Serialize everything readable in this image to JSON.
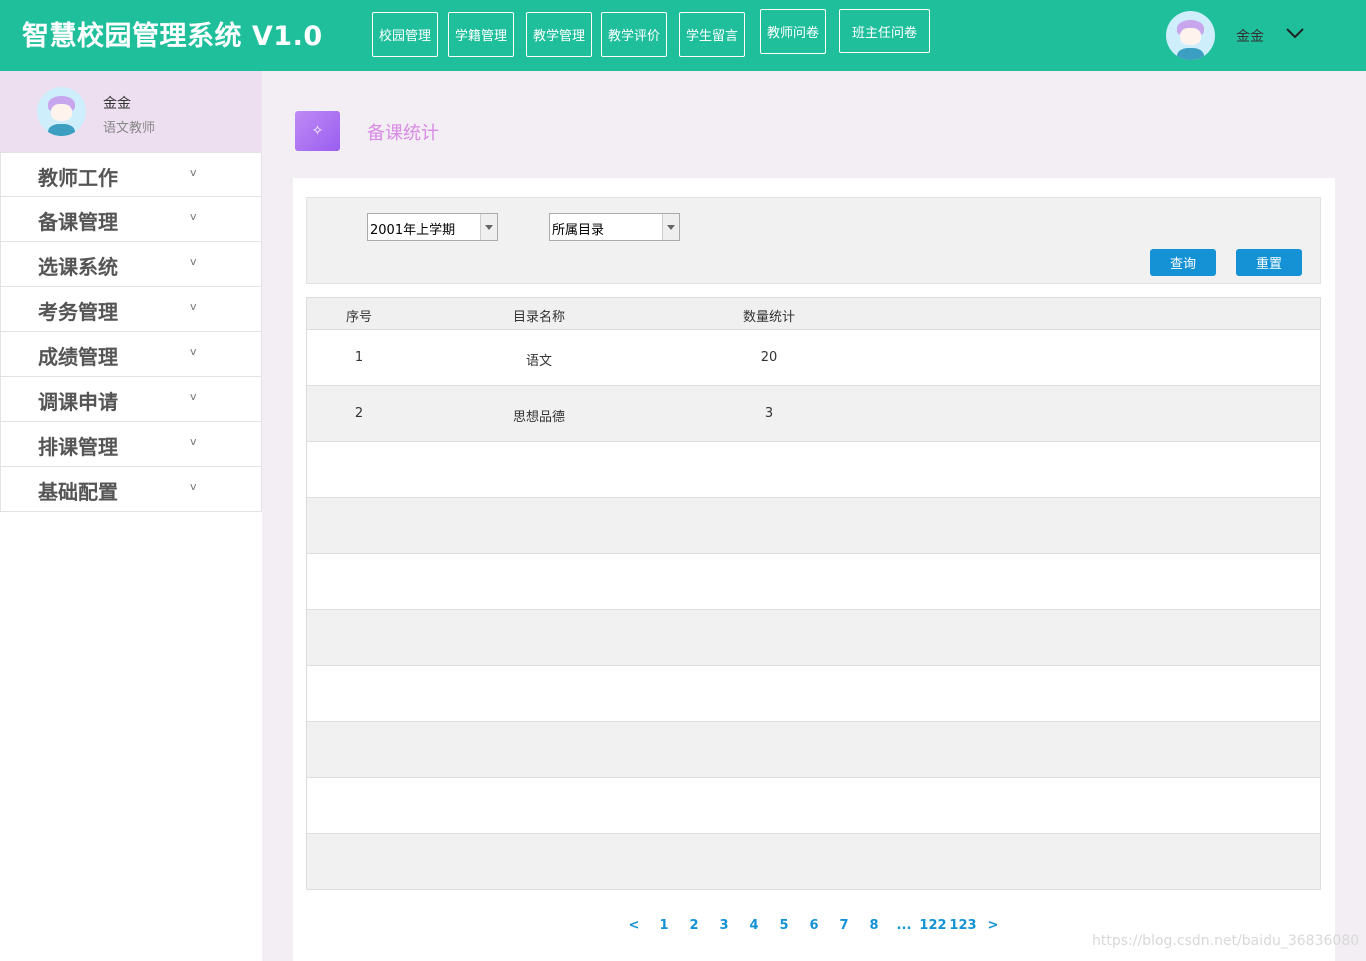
{
  "app": {
    "title": "智慧校园管理系统 V1.0"
  },
  "topnav": [
    {
      "label": "校园管理"
    },
    {
      "label": "学籍管理"
    },
    {
      "label": "教学管理"
    },
    {
      "label": "教学评价"
    },
    {
      "label": "学生留言"
    },
    {
      "label": "教师问卷"
    },
    {
      "label": "班主任问卷"
    }
  ],
  "user": {
    "name": "金金",
    "role": "语文教师"
  },
  "sidebar": {
    "items": [
      {
        "label": "教师工作",
        "caret": "v"
      },
      {
        "label": "备课管理",
        "caret": "v"
      },
      {
        "label": "选课系统",
        "caret": "v"
      },
      {
        "label": "考务管理",
        "caret": "v"
      },
      {
        "label": "成绩管理",
        "caret": "v"
      },
      {
        "label": "调课申请",
        "caret": "v"
      },
      {
        "label": "排课管理",
        "caret": "v"
      },
      {
        "label": "基础配置",
        "caret": "v"
      }
    ]
  },
  "page": {
    "title": "备课统计",
    "icon": "✧"
  },
  "filters": {
    "term": {
      "value": "2001年上学期"
    },
    "catalog": {
      "value": "所属目录"
    },
    "query_label": "查询",
    "reset_label": "重置"
  },
  "table": {
    "headers": [
      "序号",
      "目录名称",
      "数量统计"
    ],
    "rows": [
      [
        "1",
        "语文",
        "20"
      ],
      [
        "2",
        "思想品德",
        "3"
      ]
    ]
  },
  "pagination": {
    "items": [
      "<",
      "1",
      "2",
      "3",
      "4",
      "5",
      "6",
      "7",
      "8",
      "...",
      "122",
      "123",
      ">"
    ]
  },
  "watermark": "https://blog.csdn.net/baidu_36836080"
}
